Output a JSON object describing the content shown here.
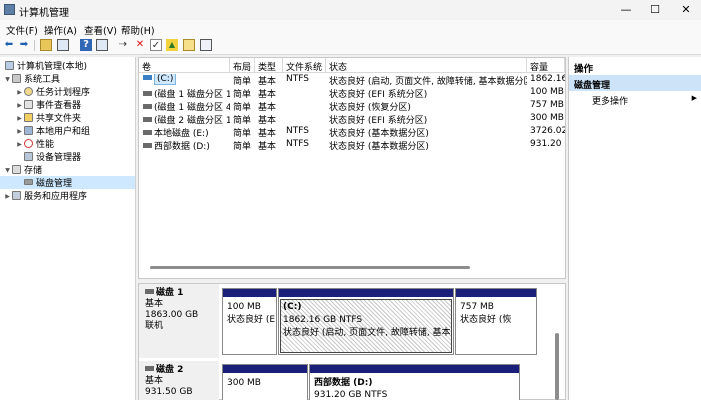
{
  "window": {
    "title": "计算机管理",
    "minimize": "—",
    "maximize": "☐",
    "close": "✕"
  },
  "menubar": [
    "文件(F)",
    "操作(A)",
    "查看(V)",
    "帮助(H)"
  ],
  "tree": {
    "root": "计算机管理(本地)",
    "system_tools": "系统工具",
    "task_scheduler": "任务计划程序",
    "event_viewer": "事件查看器",
    "shared_folders": "共享文件夹",
    "local_users": "本地用户和组",
    "performance": "性能",
    "device_manager": "设备管理器",
    "storage": "存储",
    "disk_management": "磁盘管理",
    "services": "服务和应用程序"
  },
  "volume_list": {
    "columns": [
      "卷",
      "布局",
      "类型",
      "文件系统",
      "状态",
      "容量"
    ],
    "rows": [
      {
        "volume": "(C:)",
        "layout": "简单",
        "type": "基本",
        "fs": "NTFS",
        "status": "状态良好 (启动, 页面文件, 故障转储, 基本数据分区)",
        "capacity": "1862.16"
      },
      {
        "volume": "(磁盘 1 磁盘分区 1)",
        "layout": "简单",
        "type": "基本",
        "fs": "",
        "status": "状态良好 (EFI 系统分区)",
        "capacity": "100 MB"
      },
      {
        "volume": "(磁盘 1 磁盘分区 4)",
        "layout": "简单",
        "type": "基本",
        "fs": "",
        "status": "状态良好 (恢复分区)",
        "capacity": "757 MB"
      },
      {
        "volume": "(磁盘 2 磁盘分区 1)",
        "layout": "简单",
        "type": "基本",
        "fs": "",
        "status": "状态良好 (EFI 系统分区)",
        "capacity": "300 MB"
      },
      {
        "volume": "本地磁盘 (E:)",
        "layout": "简单",
        "type": "基本",
        "fs": "NTFS",
        "status": "状态良好 (基本数据分区)",
        "capacity": "3726.02"
      },
      {
        "volume": "西部数据 (D:)",
        "layout": "简单",
        "type": "基本",
        "fs": "NTFS",
        "status": "状态良好 (基本数据分区)",
        "capacity": "931.20 G"
      }
    ]
  },
  "disks": [
    {
      "name": "磁盘 1",
      "kind": "基本",
      "size": "1863.00 GB",
      "state": "联机",
      "partitions": [
        {
          "line1": "",
          "line2": "100 MB",
          "line3": "状态良好 (E"
        },
        {
          "line1": "(C:)",
          "line2": "1862.16 GB NTFS",
          "line3": "状态良好 (启动, 页面文件, 故障转储, 基本"
        },
        {
          "line1": "",
          "line2": "757 MB",
          "line3": "状态良好 (恢"
        }
      ]
    },
    {
      "name": "磁盘 2",
      "kind": "基本",
      "size": "931.50 GB",
      "partitions": [
        {
          "line1": "",
          "line2": "300 MB"
        },
        {
          "line1": "西部数据 (D:)",
          "line2": "931.20 GB NTFS"
        }
      ]
    }
  ],
  "actions": {
    "header": "操作",
    "selected": "磁盘管理",
    "more": "更多操作"
  }
}
